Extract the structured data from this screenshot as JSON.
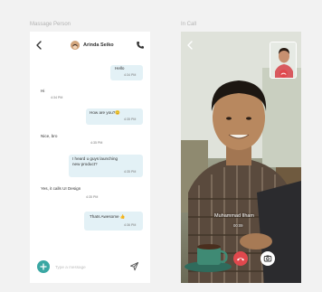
{
  "labels": {
    "left": "Massage Person",
    "right": "In Call"
  },
  "chat": {
    "contact_name": "Arinda Seiko",
    "messages": [
      {
        "dir": "out",
        "lines": [
          "Hello"
        ],
        "time": "4:34 PM"
      },
      {
        "dir": "in",
        "lines": [
          "Hi"
        ],
        "time": "4:34 PM"
      },
      {
        "dir": "out",
        "lines": [
          "How are you?😊"
        ],
        "time": "4:35 PM"
      },
      {
        "dir": "in",
        "lines": [
          "Nice, bro"
        ],
        "time": "4:35 PM"
      },
      {
        "dir": "out",
        "lines": [
          "I heard u guys launching",
          "new product?"
        ],
        "time": "4:35 PM"
      },
      {
        "dir": "in",
        "lines": [
          "Yes, it calls UI Design"
        ],
        "time": "4:35 PM"
      },
      {
        "dir": "out",
        "lines": [
          "Thats Awesome 👍"
        ],
        "time": "4:36 PM"
      }
    ],
    "composer_placeholder": "Type a message"
  },
  "call": {
    "caller_name": "Muhammad Ilham",
    "status": "00:09"
  },
  "colors": {
    "accent": "#3aa7a3",
    "bubble_out": "#e3f1f6",
    "end_call": "#e0484d"
  },
  "icons": {
    "back": "arrow-left-icon",
    "phone": "phone-icon",
    "add": "plus-icon",
    "send": "send-icon",
    "end_call": "phone-hangup-icon",
    "camera": "camera-switch-icon"
  }
}
